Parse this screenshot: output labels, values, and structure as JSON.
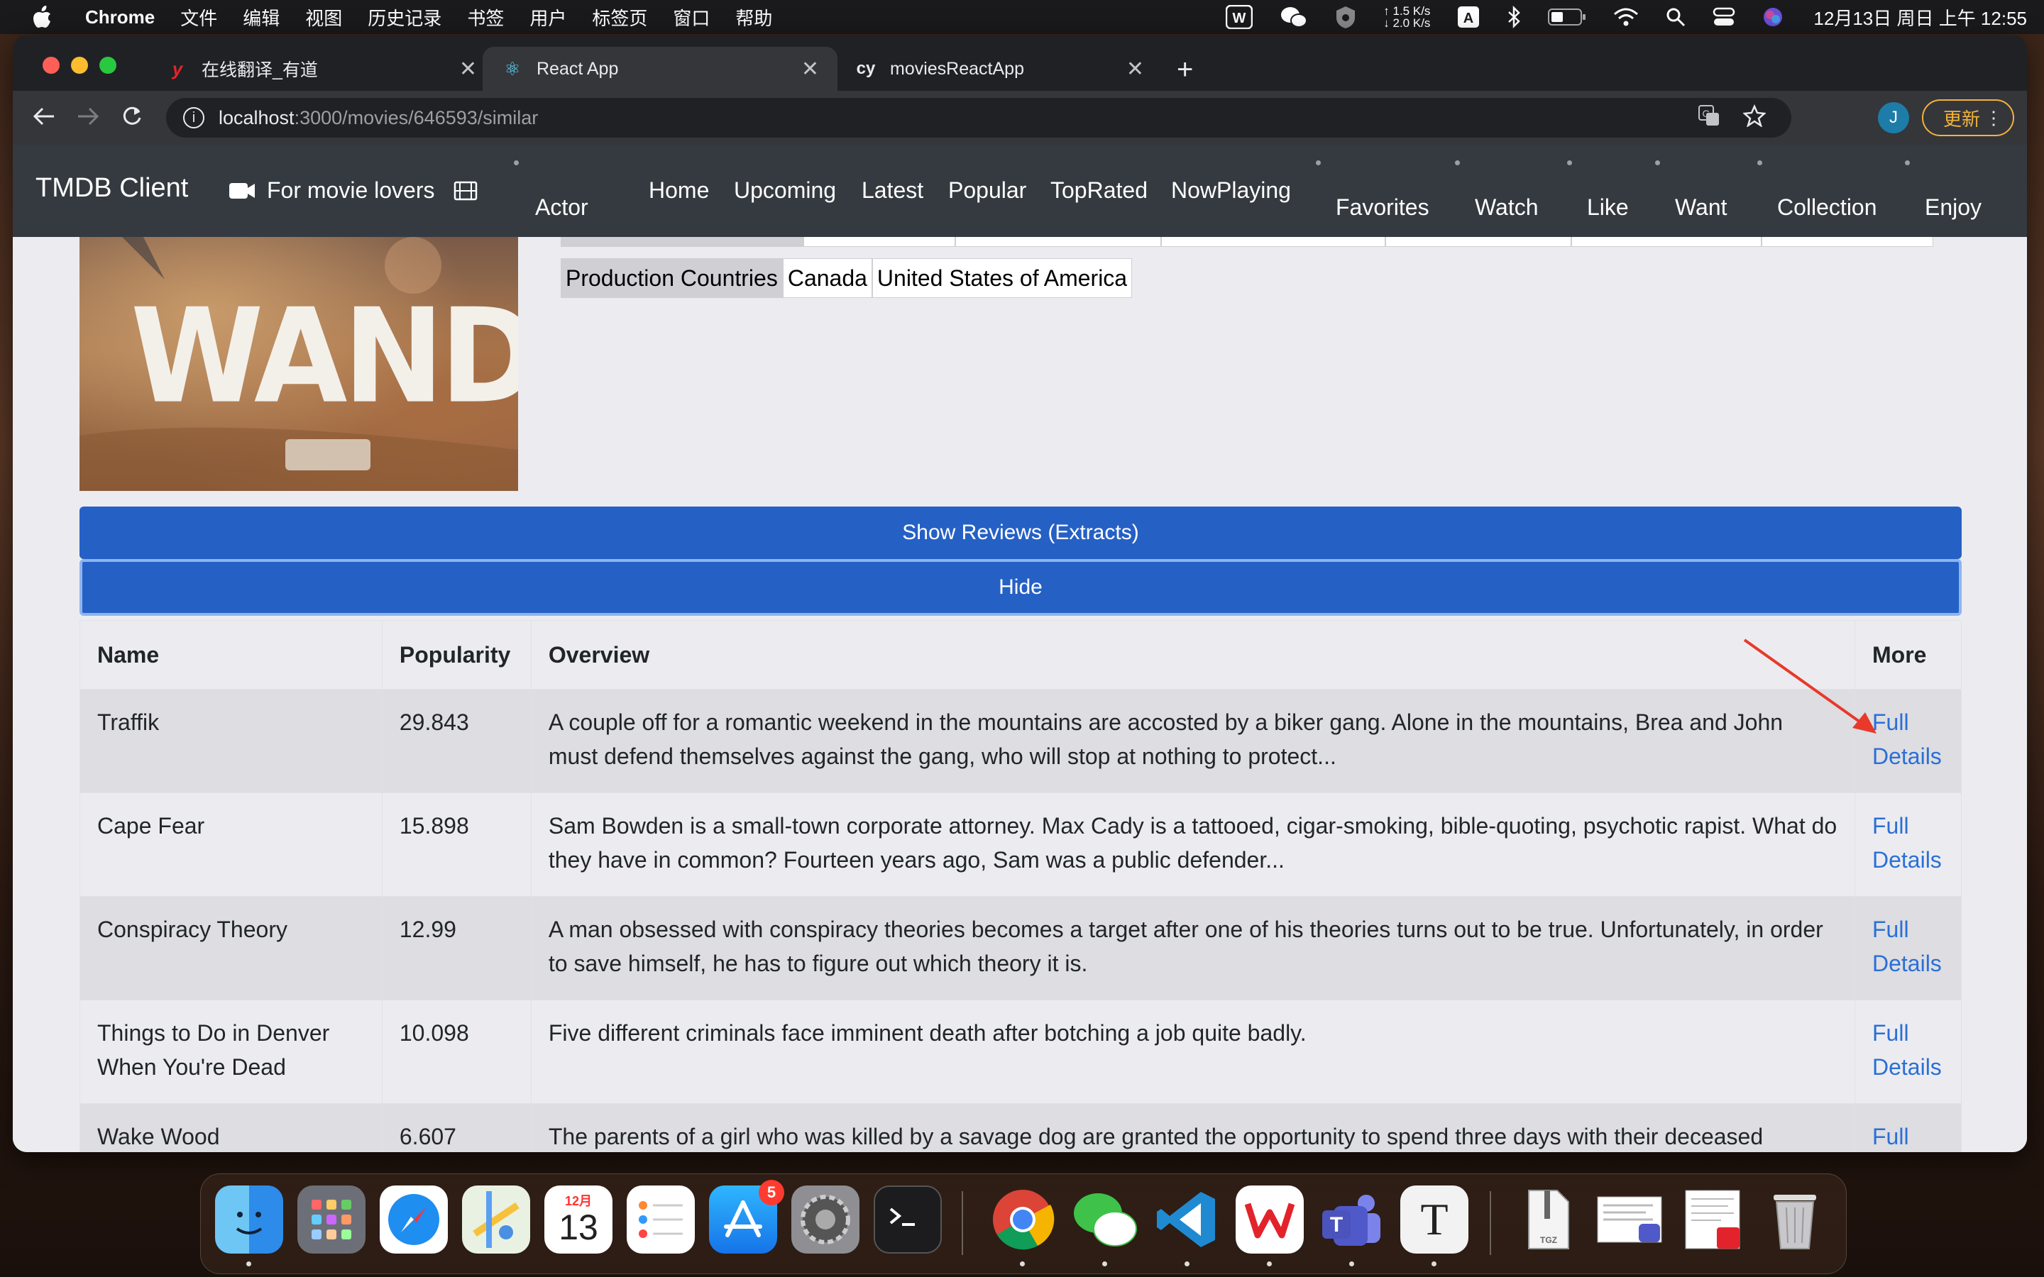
{
  "menubar": {
    "app_name": "Chrome",
    "items": [
      "文件",
      "编辑",
      "视图",
      "历史记录",
      "书签",
      "用户",
      "标签页",
      "窗口",
      "帮助"
    ],
    "net_up": "↑ 1.5 K/s",
    "net_down": "↓ 2.0 K/s",
    "input_method": "A",
    "datetime": "12月13日 周日 上午 12:55"
  },
  "browser": {
    "tabs": [
      {
        "favicon": "y",
        "title": "在线翻译_有道"
      },
      {
        "favicon": "⚛",
        "title": "React App"
      },
      {
        "favicon": "cy",
        "title": "moviesReactApp"
      }
    ],
    "url_host": "localhost",
    "url_path": ":3000/movies/646593/similar",
    "profile_initial": "J",
    "update_label": "更新"
  },
  "app": {
    "brand": "TMDB Client",
    "tagline": "For movie lovers",
    "nav_actor": "Actor",
    "nav_main": [
      "Home",
      "Upcoming",
      "Latest",
      "Popular",
      "TopRated",
      "NowPlaying"
    ],
    "nav_user": [
      "Favorites",
      "Watch",
      "Like",
      "Want",
      "Collection",
      "Enjoy"
    ]
  },
  "poster": {
    "title": "WANDER"
  },
  "production_countries": {
    "label": "Production Countries",
    "values": [
      "Canada",
      "United States of America"
    ]
  },
  "buttons": {
    "show_reviews": "Show Reviews (Extracts)",
    "hide": "Hide"
  },
  "table": {
    "headers": [
      "Name",
      "Popularity",
      "Overview",
      "More"
    ],
    "rows": [
      {
        "name": "Traffik",
        "popularity": "29.843",
        "overview": "A couple off for a romantic weekend in the mountains are accosted by a biker gang. Alone in the mountains, Brea and John must defend themselves against the gang, who will stop at nothing to protect...",
        "more": "Full Details"
      },
      {
        "name": "Cape Fear",
        "popularity": "15.898",
        "overview": "Sam Bowden is a small-town corporate attorney. Max Cady is a tattooed, cigar-smoking, bible-quoting, psychotic rapist. What do they have in common? Fourteen years ago, Sam was a public defender...",
        "more": "Full Details"
      },
      {
        "name": "Conspiracy Theory",
        "popularity": "12.99",
        "overview": "A man obsessed with conspiracy theories becomes a target after one of his theories turns out to be true. Unfortunately, in order to save himself, he has to figure out which theory it is.",
        "more": "Full Details"
      },
      {
        "name": "Things to Do in Denver When You're Dead",
        "popularity": "10.098",
        "overview": "Five different criminals face imminent death after botching a job quite badly.",
        "more": "Full Details"
      },
      {
        "name": "Wake Wood",
        "popularity": "6.607",
        "overview": "The parents of a girl who was killed by a savage dog are granted the opportunity to spend three days with their deceased daughter...",
        "more": "Full Details"
      }
    ]
  },
  "dock": {
    "calendar_month": "12月",
    "calendar_day": "13",
    "appstore_badge": "5",
    "textedit_letter": "T",
    "archive_label": "TGZ"
  }
}
